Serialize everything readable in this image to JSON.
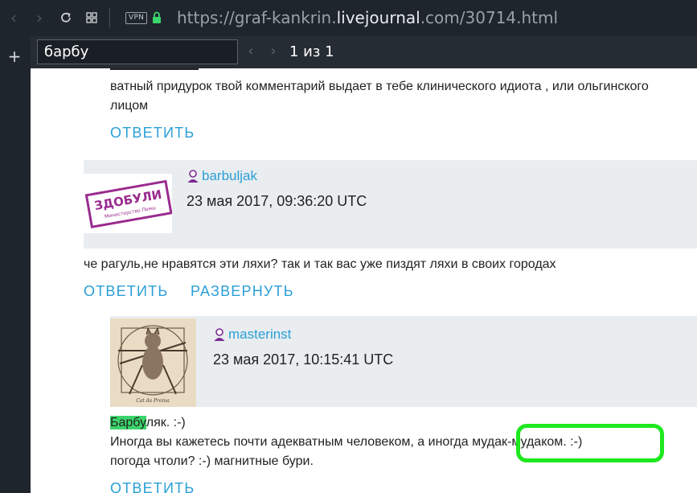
{
  "browser": {
    "url_prefix": "https://graf-kankrin.",
    "url_host": "livejournal",
    "url_suffix": ".com/30714.html",
    "vpn_label": "VPN",
    "icons": [
      "back-icon",
      "forward-icon",
      "reload-icon",
      "tabs-grid-icon",
      "lock-icon",
      "plus-icon"
    ]
  },
  "findbar": {
    "query": "барбу",
    "count_text": "1 из 1",
    "prev_icon": "chevron-left-icon",
    "next_icon": "chevron-right-icon"
  },
  "comments": {
    "top": {
      "line1": "ватный придурок твой комментарий выдает в тебе клинического идиота , или ольгинского",
      "line2": "лицом",
      "reply_label": "ОТВЕТИТЬ"
    },
    "c1": {
      "username": "barbuljak",
      "date": "23 мая 2017, 09:36:20 UTC",
      "avatar_text": "ЗДОБУЛИ",
      "avatar_subtext": "Министерство Пемы",
      "body": "че рагуль,не нравятся эти ляхи? так и так вас уже пиздят ляхи в своих городах",
      "reply_label": "ОТВЕТИТЬ",
      "expand_label": "РАЗВЕРНУТЬ"
    },
    "c2": {
      "username": "masterinst",
      "date": "23 мая 2017, 10:15:41 UTC",
      "avatar_caption": "Cat da Proma",
      "line1_highlight": "Барбу",
      "line1_rest": "ляк. :-)",
      "line2_start": "Иногда вы кажетесь почти адекватным человеком, а иногда ",
      "line2_circled": "мудак-мудаком. :-)",
      "line3": "погода чтоли? :-) магнитные бури.",
      "reply_label": "ОТВЕТИТЬ"
    }
  },
  "colors": {
    "chrome": "#1f252d",
    "link": "#2a9fd6",
    "highlight": "#3bd46b",
    "circle": "#1ee81e"
  }
}
